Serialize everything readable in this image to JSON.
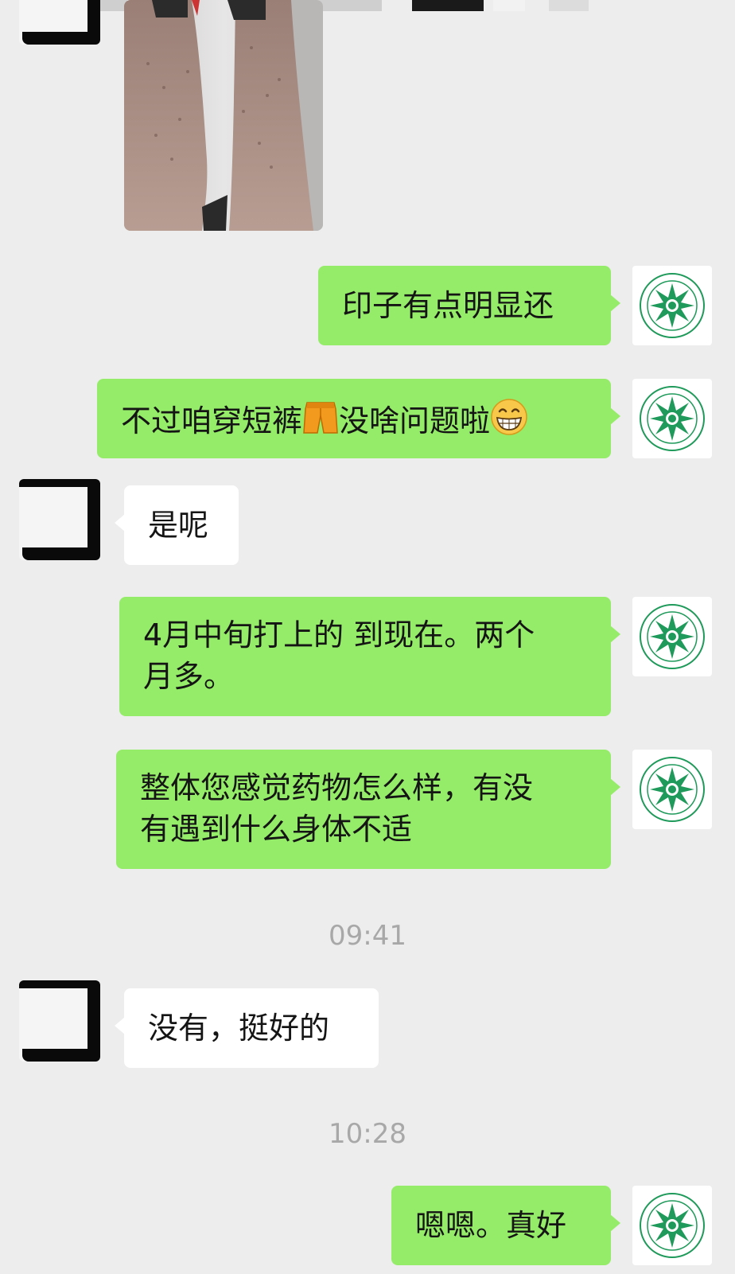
{
  "colors": {
    "background": "#ededed",
    "self_bubble": "#95ec69",
    "other_bubble": "#ffffff",
    "timestamp": "#a8a8a8",
    "avatar_green": "#1f9a5a"
  },
  "icons": {
    "shorts": "shorts-emoji-icon",
    "grin": "grinning-face-emoji-icon",
    "avatar": "green-star-seal-logo"
  },
  "messages": [
    {
      "side": "other",
      "type": "image",
      "content": "photo-of-legs"
    },
    {
      "side": "self",
      "text": "印子有点明显还"
    },
    {
      "side": "self",
      "text_before": "不过咱穿短裤",
      "text_middle": "没啥问题啦"
    },
    {
      "side": "other",
      "text": "是呢"
    },
    {
      "side": "self",
      "line1": "4月中旬打上的 到现在。两个",
      "line2": "月多。"
    },
    {
      "side": "self",
      "line1": "整体您感觉药物怎么样，有没",
      "line2": "有遇到什么身体不适"
    },
    {
      "side": "other",
      "text": "没有，挺好的"
    },
    {
      "side": "self",
      "text": "嗯嗯。真好"
    }
  ],
  "timestamps": [
    "09:41",
    "10:28"
  ]
}
